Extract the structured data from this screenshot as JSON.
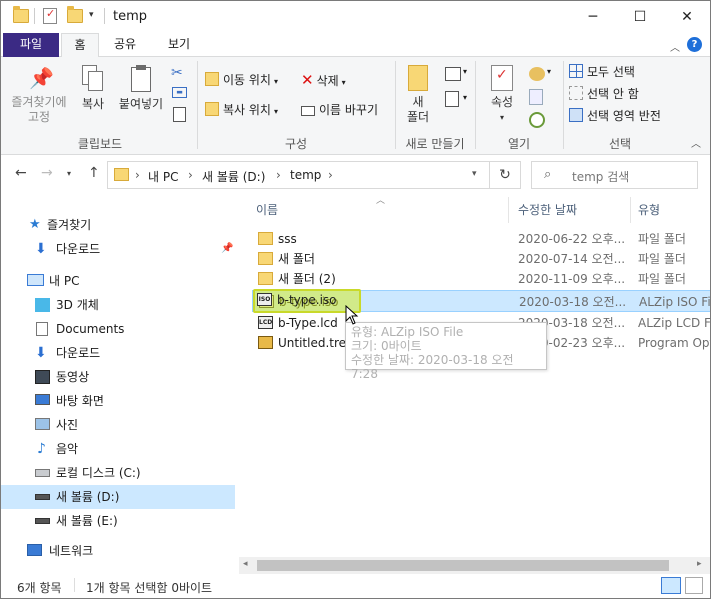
{
  "window": {
    "title": "temp",
    "minimize_icon": "minimize-icon",
    "maximize_icon": "maximize-icon",
    "close_icon": "close-icon"
  },
  "ribbon_tabs": [
    "파일",
    "홈",
    "공유",
    "보기"
  ],
  "ribbon": {
    "clipboard": {
      "pin_label": "즐겨찾기에\n고정",
      "copy_label": "복사",
      "paste_label": "붙여넣기",
      "group_label": "클립보드"
    },
    "organize": {
      "move_to": "이동 위치",
      "copy_to": "복사 위치",
      "delete": "삭제",
      "rename": "이름 바꾸기",
      "group_label": "구성"
    },
    "new": {
      "new_folder": "새\n폴더",
      "group_label": "새로 만들기"
    },
    "open": {
      "properties": "속성",
      "group_label": "열기"
    },
    "select": {
      "select_all": "모두 선택",
      "select_none": "선택 안 함",
      "invert": "선택 영역 반전",
      "group_label": "선택"
    }
  },
  "address": {
    "crumbs": [
      "내 PC",
      "새 볼륨 (D:)",
      "temp"
    ],
    "search_placeholder": "temp 검색"
  },
  "nav": {
    "items": [
      {
        "label": "즐겨찾기",
        "icon": "star-icon"
      },
      {
        "label": "다운로드",
        "icon": "download-icon"
      },
      {
        "label": "내 PC",
        "icon": "pc-icon"
      },
      {
        "label": "3D 개체",
        "icon": "cube-icon"
      },
      {
        "label": "Documents",
        "icon": "document-icon"
      },
      {
        "label": "다운로드",
        "icon": "download-icon"
      },
      {
        "label": "동영상",
        "icon": "video-icon"
      },
      {
        "label": "바탕 화면",
        "icon": "desktop-icon"
      },
      {
        "label": "사진",
        "icon": "picture-icon"
      },
      {
        "label": "음악",
        "icon": "music-icon"
      },
      {
        "label": "로컬 디스크 (C:)",
        "icon": "drive-icon"
      },
      {
        "label": "새 볼륨 (D:)",
        "icon": "drive-icon"
      },
      {
        "label": "새 볼륨 (E:)",
        "icon": "drive-icon"
      },
      {
        "label": "네트워크",
        "icon": "network-icon"
      }
    ]
  },
  "columns": {
    "name": "이름",
    "date": "수정한 날짜",
    "type": "유형"
  },
  "files": [
    {
      "name": "sss",
      "date": "2020-06-22 오후...",
      "type": "파일 폴더"
    },
    {
      "name": "새 폴더",
      "date": "2020-07-14 오전...",
      "type": "파일 폴더"
    },
    {
      "name": "새 폴더 (2)",
      "date": "2020-11-09 오후...",
      "type": "파일 폴더"
    },
    {
      "name": "b-type.iso",
      "date": "2020-03-18 오전...",
      "type": "ALZip ISO File"
    },
    {
      "name": "b-Type.lcd",
      "date": "2020-03-18 오전...",
      "type": "ALZip LCD File"
    },
    {
      "name": "Untitled.treeDB",
      "date": "2020-02-23 오후...",
      "type": "Program Opti"
    }
  ],
  "tooltip": {
    "type": "유형: ALZip ISO File",
    "size": "크기: 0바이트",
    "modified": "수정한 날짜: 2020-03-18 오전 7:28"
  },
  "status": {
    "count": "6개 항목",
    "selection": "1개 항목 선택함 0바이트"
  }
}
